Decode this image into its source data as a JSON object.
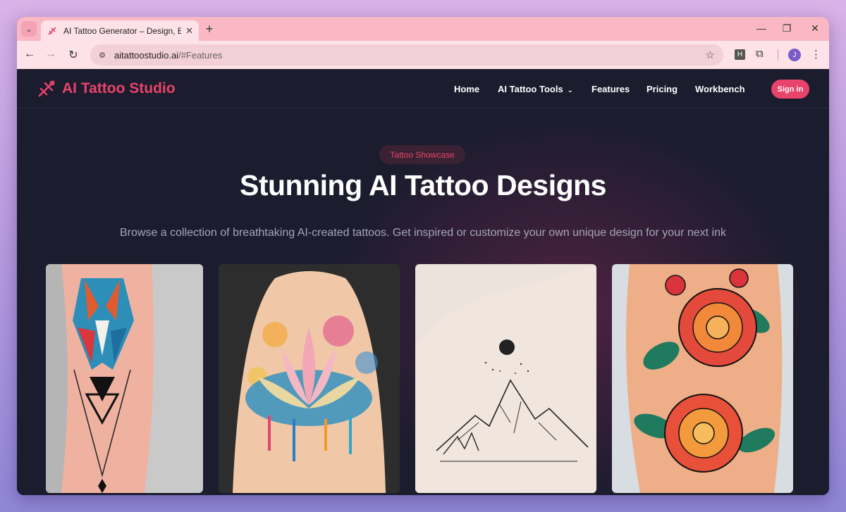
{
  "browser": {
    "tab_title": "AI Tattoo Generator – Design, E",
    "url_domain": "aitattoostudio.ai",
    "url_path": "/#Features",
    "profile_initial": "J",
    "extension_label": "H"
  },
  "site": {
    "logo_text": "AI Tattoo Studio",
    "brand_color": "#e8436a",
    "nav": {
      "home": "Home",
      "tools": "AI Tattoo Tools",
      "features": "Features",
      "pricing": "Pricing",
      "workbench": "Workbench"
    },
    "signin_label": "Sign in"
  },
  "showcase": {
    "badge": "Tattoo Showcase",
    "title": "Stunning AI Tattoo Designs",
    "subtitle": "Browse a collection of breathtaking AI-created tattoos. Get inspired or customize your own unique design for your next ink",
    "images": [
      {
        "subject": "geometric wolf forearm tattoo"
      },
      {
        "subject": "watercolor lotus back tattoo"
      },
      {
        "subject": "minimalist mountain line tattoo"
      },
      {
        "subject": "traditional red roses arm tattoo"
      }
    ]
  }
}
